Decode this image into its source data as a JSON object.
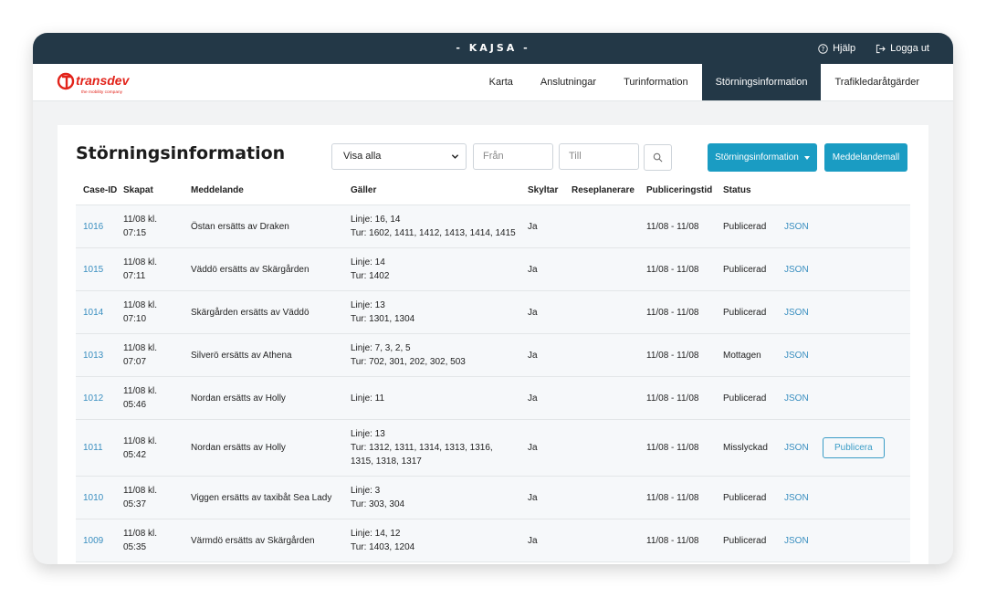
{
  "header": {
    "title": "- KAJSA -",
    "help_label": "Hjälp",
    "logout_label": "Logga ut"
  },
  "logo": {
    "brand": "transdev",
    "tagline": "the mobility company",
    "color": "#e2231a"
  },
  "nav": {
    "items": [
      "Karta",
      "Anslutningar",
      "Turinformation",
      "Störningsinformation",
      "Trafikledaråtgärder"
    ],
    "active": "Störningsinformation"
  },
  "page": {
    "title": "Störningsinformation",
    "filter_value": "Visa alla",
    "from_placeholder": "Från",
    "to_placeholder": "Till",
    "dropdown_button": "Störningsinformation",
    "template_button": "Meddelandemall"
  },
  "table": {
    "headers": [
      "Case-ID",
      "Skapat",
      "Meddelande",
      "Gäller",
      "Skyltar",
      "Reseplanerare",
      "Publiceringstid",
      "Status"
    ],
    "rows": [
      {
        "id": "1016",
        "created": [
          "11/08 kl.",
          "07:15"
        ],
        "message": "Östan ersätts av Draken",
        "applies": [
          "Linje: 16, 14",
          "Tur: 1602, 1411, 1412, 1413, 1414, 1415"
        ],
        "signs": "Ja",
        "planner": "",
        "period": "11/08 - 11/08",
        "status": "Publicerad",
        "json": "JSON"
      },
      {
        "id": "1015",
        "created": [
          "11/08 kl.",
          "07:11"
        ],
        "message": "Väddö ersätts av Skärgården",
        "applies": [
          "Linje: 14",
          "Tur: 1402"
        ],
        "signs": "Ja",
        "planner": "",
        "period": "11/08 - 11/08",
        "status": "Publicerad",
        "json": "JSON"
      },
      {
        "id": "1014",
        "created": [
          "11/08 kl.",
          "07:10"
        ],
        "message": "Skärgården ersätts av Väddö",
        "applies": [
          "Linje: 13",
          "Tur: 1301, 1304"
        ],
        "signs": "Ja",
        "planner": "",
        "period": "11/08 - 11/08",
        "status": "Publicerad",
        "json": "JSON"
      },
      {
        "id": "1013",
        "created": [
          "11/08 kl.",
          "07:07"
        ],
        "message": "Silverö ersätts av Athena",
        "applies": [
          "Linje: 7, 3, 2, 5",
          "Tur: 702, 301, 202, 302, 503"
        ],
        "signs": "Ja",
        "planner": "",
        "period": "11/08 - 11/08",
        "status": "Mottagen",
        "json": "JSON"
      },
      {
        "id": "1012",
        "created": [
          "11/08 kl.",
          "05:46"
        ],
        "message": "Nordan ersätts av Holly",
        "applies": [
          "Linje: 11"
        ],
        "signs": "Ja",
        "planner": "",
        "period": "11/08 - 11/08",
        "status": "Publicerad",
        "json": "JSON"
      },
      {
        "id": "1011",
        "created": [
          "11/08 kl.",
          "05:42"
        ],
        "message": "Nordan ersätts av Holly",
        "applies": [
          "Linje: 13",
          "Tur: 1312, 1311, 1314, 1313, 1316,",
          "1315, 1318, 1317"
        ],
        "signs": "Ja",
        "planner": "",
        "period": "11/08 - 11/08",
        "status": "Misslyckad",
        "json": "JSON",
        "action": "Publicera"
      },
      {
        "id": "1010",
        "created": [
          "11/08 kl.",
          "05:37"
        ],
        "message": "Viggen ersätts av taxibåt Sea Lady",
        "applies": [
          "Linje: 3",
          "Tur: 303, 304"
        ],
        "signs": "Ja",
        "planner": "",
        "period": "11/08 - 11/08",
        "status": "Publicerad",
        "json": "JSON"
      },
      {
        "id": "1009",
        "created": [
          "11/08 kl.",
          "05:35"
        ],
        "message": "Värmdö ersätts av Skärgården",
        "applies": [
          "Linje: 14, 12",
          "Tur: 1403, 1204"
        ],
        "signs": "Ja",
        "planner": "",
        "period": "11/08 - 11/08",
        "status": "Publicerad",
        "json": "JSON"
      }
    ]
  },
  "colors": {
    "header_bg": "#233847",
    "accent": "#1a9cc3",
    "link": "#3a8fc0"
  }
}
